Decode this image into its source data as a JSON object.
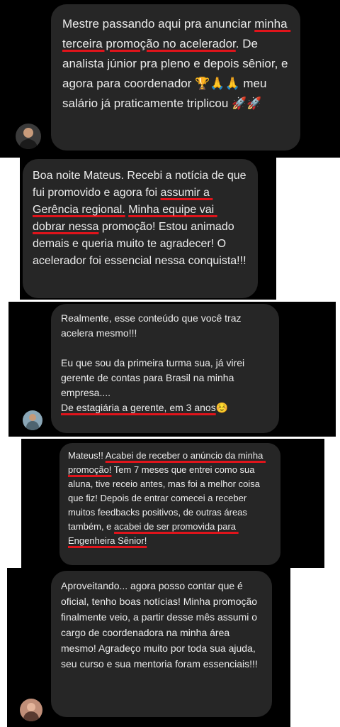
{
  "chats": [
    {
      "segments": [
        {
          "text": "Mestre passando aqui pra anunciar ",
          "u": false
        },
        {
          "text": "minha terceira promoção no acelerador",
          "u": true
        },
        {
          "text": ". De analista júnior pra pleno e depois sênior, e agora para coordenador 🏆🙏🙏 meu salário já praticamente triplicou 🚀🚀",
          "u": false
        }
      ],
      "avatar": "man-avatar"
    },
    {
      "segments": [
        {
          "text": "Boa noite Mateus. Recebi a notícia de que fui promovido e agora foi ",
          "u": false
        },
        {
          "text": "assumir a Gerência regional.",
          "u": true
        },
        {
          "text": " ",
          "u": false
        },
        {
          "text": "Minha equipe vai dobrar nessa",
          "u": true
        },
        {
          "text": " promoção! Estou animado demais e queria muito te agradecer! O acelerador foi essencial nessa conquista!!!",
          "u": false
        }
      ]
    },
    {
      "segments": [
        {
          "text": "Realmente, esse conteúdo que você traz acelera mesmo!!!\n\nEu que sou da primeira turma sua, já virei gerente de contas para Brasil na minha empresa....\n",
          "u": false
        },
        {
          "text": "De estagiária a gerente, em 3 anos",
          "u": true
        },
        {
          "text": "☺️",
          "u": false
        }
      ],
      "avatar": "woman-avatar"
    },
    {
      "segments": [
        {
          "text": "Mateus!! ",
          "u": false
        },
        {
          "text": "Acabei de receber o anúncio da minha promoção!",
          "u": true
        },
        {
          "text": " Tem 7 meses que entrei como sua aluna, tive receio antes, mas foi a melhor coisa que fiz! Depois de entrar comecei a receber muitos feedbacks positivos, de outras áreas também, e ",
          "u": false
        },
        {
          "text": "acabei de ser promovida para Engenheira Sênior!",
          "u": true
        }
      ]
    },
    {
      "segments": [
        {
          "text": "Aproveitando... agora posso contar que é oficial, tenho boas notícias! Minha promoção finalmente veio, a partir desse mês assumi o cargo de coordenadora na minha área mesmo! Agradeço muito por toda sua ajuda, seu curso e sua mentoria foram essenciais!!!",
          "u": false
        }
      ],
      "avatar": "woman-avatar"
    }
  ],
  "colors": {
    "bubble": "#262626",
    "text": "#ececec",
    "underline": "#e0141b",
    "panel": "#000000"
  }
}
